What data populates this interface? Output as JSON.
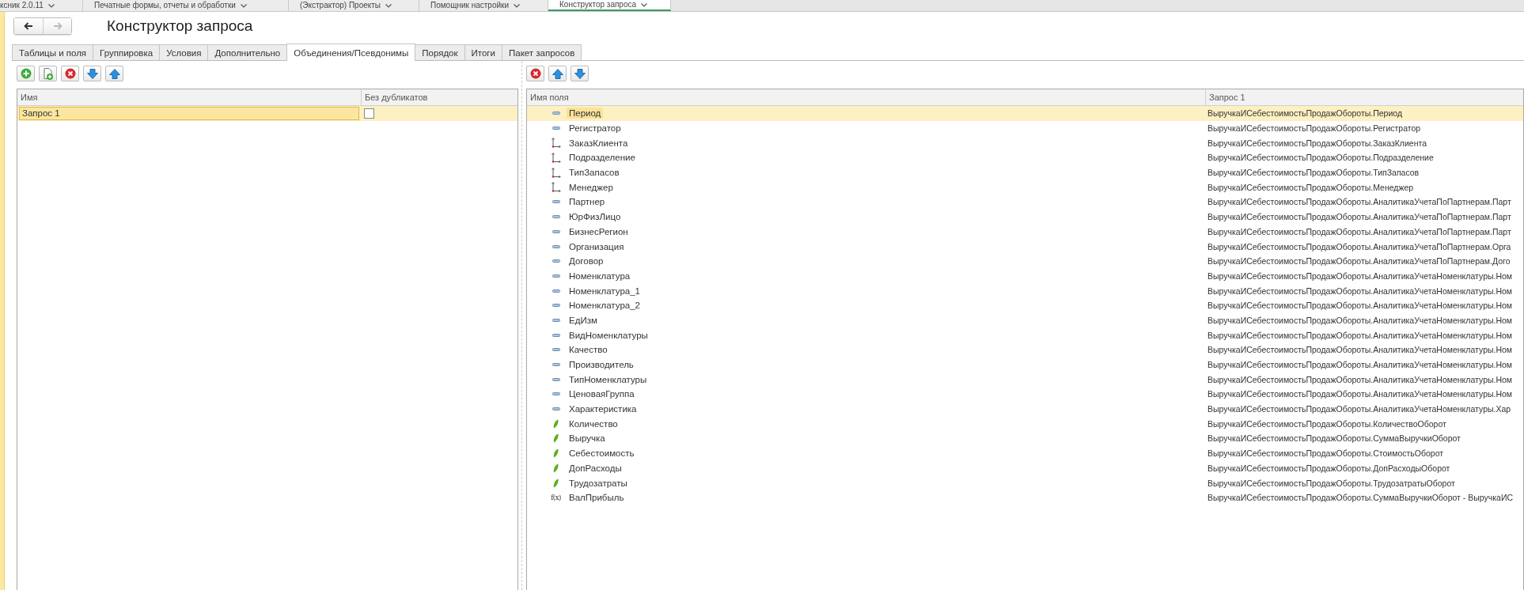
{
  "window_tabs": [
    {
      "label": "ксник 2.0.11",
      "selected": false
    },
    {
      "label": "Печатные формы, отчеты и обработки",
      "selected": false
    },
    {
      "label": "(Экстрактор) Проекты",
      "selected": false
    },
    {
      "label": "Помощник настройки",
      "selected": false
    },
    {
      "label": "Конструктор запроса",
      "selected": true
    }
  ],
  "navigation": {
    "back": {
      "disabled": false
    },
    "forward": {
      "disabled": true
    }
  },
  "title": "Конструктор запроса",
  "tabs": [
    {
      "label": "Таблицы и поля",
      "selected": false
    },
    {
      "label": "Группировка",
      "selected": false
    },
    {
      "label": "Условия",
      "selected": false
    },
    {
      "label": "Дополнительно",
      "selected": false
    },
    {
      "label": "Объединения/Псевдонимы",
      "selected": true
    },
    {
      "label": "Порядок",
      "selected": false
    },
    {
      "label": "Итоги",
      "selected": false
    },
    {
      "label": "Пакет запросов",
      "selected": false
    }
  ],
  "queries_table": {
    "columns": [
      "Имя",
      "Без дубликатов"
    ],
    "rows": [
      {
        "name": "Запрос 1",
        "no_duplicates": false,
        "selected": true
      }
    ]
  },
  "fields_table": {
    "columns": [
      "Имя поля",
      "Запрос 1"
    ],
    "rows": [
      {
        "kind": "field",
        "name": "Период",
        "source": "ВыручкаИСебестоимостьПродажОбороты.Период",
        "selected": true
      },
      {
        "kind": "field",
        "name": "Регистратор",
        "source": "ВыручкаИСебестоимостьПродажОбороты.Регистратор",
        "selected": false
      },
      {
        "kind": "reference",
        "name": "ЗаказКлиента",
        "source": "ВыручкаИСебестоимостьПродажОбороты.ЗаказКлиента",
        "selected": false
      },
      {
        "kind": "reference",
        "name": "Подразделение",
        "source": "ВыручкаИСебестоимостьПродажОбороты.Подразделение",
        "selected": false
      },
      {
        "kind": "reference",
        "name": "ТипЗапасов",
        "source": "ВыручкаИСебестоимостьПродажОбороты.ТипЗапасов",
        "selected": false
      },
      {
        "kind": "reference",
        "name": "Менеджер",
        "source": "ВыручкаИСебестоимостьПродажОбороты.Менеджер",
        "selected": false
      },
      {
        "kind": "field",
        "name": "Партнер",
        "source": "ВыручкаИСебестоимостьПродажОбороты.АналитикаУчетаПоПартнерам.Парт",
        "selected": false
      },
      {
        "kind": "field",
        "name": "ЮрФизЛицо",
        "source": "ВыручкаИСебестоимостьПродажОбороты.АналитикаУчетаПоПартнерам.Парт",
        "selected": false
      },
      {
        "kind": "field",
        "name": "БизнесРегион",
        "source": "ВыручкаИСебестоимостьПродажОбороты.АналитикаУчетаПоПартнерам.Парт",
        "selected": false
      },
      {
        "kind": "field",
        "name": "Организация",
        "source": "ВыручкаИСебестоимостьПродажОбороты.АналитикаУчетаПоПартнерам.Орга",
        "selected": false
      },
      {
        "kind": "field",
        "name": "Договор",
        "source": "ВыручкаИСебестоимостьПродажОбороты.АналитикаУчетаПоПартнерам.Дого",
        "selected": false
      },
      {
        "kind": "field",
        "name": "Номенклатура",
        "source": "ВыручкаИСебестоимостьПродажОбороты.АналитикаУчетаНоменклатуры.Ном",
        "selected": false
      },
      {
        "kind": "field",
        "name": "Номенклатура_1",
        "source": "ВыручкаИСебестоимостьПродажОбороты.АналитикаУчетаНоменклатуры.Ном",
        "selected": false
      },
      {
        "kind": "field",
        "name": "Номенклатура_2",
        "source": "ВыручкаИСебестоимостьПродажОбороты.АналитикаУчетаНоменклатуры.Ном",
        "selected": false
      },
      {
        "kind": "field",
        "name": "ЕдИзм",
        "source": "ВыручкаИСебестоимостьПродажОбороты.АналитикаУчетаНоменклатуры.Ном",
        "selected": false
      },
      {
        "kind": "field",
        "name": "ВидНоменклатуры",
        "source": "ВыручкаИСебестоимостьПродажОбороты.АналитикаУчетаНоменклатуры.Ном",
        "selected": false
      },
      {
        "kind": "field",
        "name": "Качество",
        "source": "ВыручкаИСебестоимостьПродажОбороты.АналитикаУчетаНоменклатуры.Ном",
        "selected": false
      },
      {
        "kind": "field",
        "name": "Производитель",
        "source": "ВыручкаИСебестоимостьПродажОбороты.АналитикаУчетаНоменклатуры.Ном",
        "selected": false
      },
      {
        "kind": "field",
        "name": "ТипНоменклатуры",
        "source": "ВыручкаИСебестоимостьПродажОбороты.АналитикаУчетаНоменклатуры.Ном",
        "selected": false
      },
      {
        "kind": "field",
        "name": "ЦеноваяГруппа",
        "source": "ВыручкаИСебестоимостьПродажОбороты.АналитикаУчетаНоменклатуры.Ном",
        "selected": false
      },
      {
        "kind": "field",
        "name": "Характеристика",
        "source": "ВыручкаИСебестоимостьПродажОбороты.АналитикаУчетаНоменклатуры.Хар",
        "selected": false
      },
      {
        "kind": "resource",
        "name": "Количество",
        "source": "ВыручкаИСебестоимостьПродажОбороты.КоличествоОборот",
        "selected": false
      },
      {
        "kind": "resource",
        "name": "Выручка",
        "source": "ВыручкаИСебестоимостьПродажОбороты.СуммаВыручкиОборот",
        "selected": false
      },
      {
        "kind": "resource",
        "name": "Себестоимость",
        "source": "ВыручкаИСебестоимостьПродажОбороты.СтоимостьОборот",
        "selected": false
      },
      {
        "kind": "resource",
        "name": "ДопРасходы",
        "source": "ВыручкаИСебестоимостьПродажОбороты.ДопРасходыОборот",
        "selected": false
      },
      {
        "kind": "resource",
        "name": "Трудозатраты",
        "source": "ВыручкаИСебестоимостьПродажОбороты.ТрудозатратыОборот",
        "selected": false
      },
      {
        "kind": "expression",
        "icon": "f(x)",
        "name": "ВалПрибыль",
        "source": "ВыручкаИСебестоимостьПродажОбороты.СуммаВыручкиОборот - ВыручкаИС",
        "selected": false
      }
    ]
  }
}
